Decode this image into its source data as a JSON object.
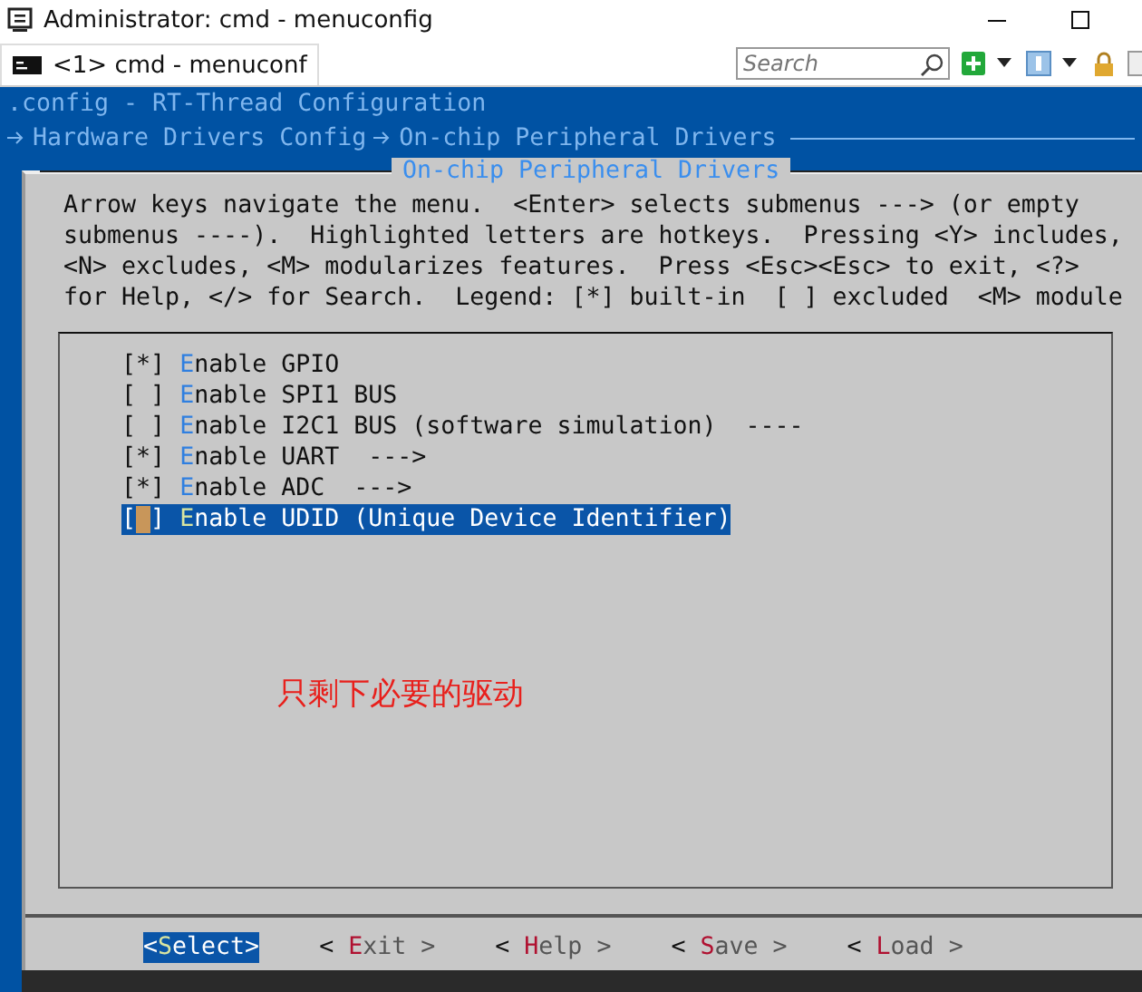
{
  "window": {
    "title": "Administrator: cmd - menuconfig"
  },
  "tabs": [
    {
      "label": "<1> cmd - menuconf",
      "selected": true
    }
  ],
  "search": {
    "placeholder": "Search"
  },
  "terminal": {
    "header": ".config - RT-Thread Configuration",
    "breadcrumb": [
      "Hardware Drivers Config",
      "On-chip Peripheral Drivers"
    ]
  },
  "dialog": {
    "title": "On-chip Peripheral Drivers",
    "help_lines": [
      "Arrow keys navigate the menu.  <Enter> selects submenus ---> (or empty",
      "submenus ----).  Highlighted letters are hotkeys.  Pressing <Y> includes,",
      "<N> excludes, <M> modularizes features.  Press <Esc><Esc> to exit, <?>",
      "for Help, </> for Search.  Legend: [*] built-in  [ ] excluded  <M> module"
    ],
    "items": [
      {
        "box": "[*]",
        "label": "Enable GPIO",
        "selected": false
      },
      {
        "box": "[ ]",
        "label": "Enable SPI1 BUS",
        "selected": false
      },
      {
        "box": "[ ]",
        "label": "Enable I2C1 BUS (software simulation)  ----",
        "selected": false
      },
      {
        "box": "[*]",
        "label": "Enable UART  --->",
        "selected": false
      },
      {
        "box": "[*]",
        "label": "Enable ADC  --->",
        "selected": false
      },
      {
        "box": "[ ]",
        "label": "Enable UDID (Unique Device Identifier)",
        "selected": true
      }
    ],
    "annotation": "只剩下必要的驱动",
    "buttons": [
      {
        "label": "<Select>",
        "selected": true
      },
      {
        "label": "< Exit >",
        "selected": false
      },
      {
        "label": "< Help >",
        "selected": false
      },
      {
        "label": "< Save >",
        "selected": false
      },
      {
        "label": "< Load >",
        "selected": false
      }
    ]
  }
}
